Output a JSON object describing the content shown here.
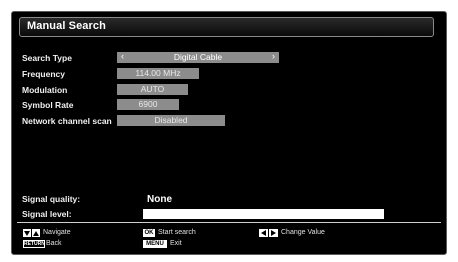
{
  "title": "Manual Search",
  "fields": {
    "search_type": {
      "label": "Search Type",
      "value": "Digital Cable"
    },
    "frequency": {
      "label": "Frequency",
      "value": "114.00 MHz"
    },
    "modulation": {
      "label": "Modulation",
      "value": "AUTO"
    },
    "symbol_rate": {
      "label": "Symbol Rate",
      "value": "6900"
    },
    "network_scan": {
      "label": "Network channel scan",
      "value": "Disabled"
    }
  },
  "signal": {
    "quality_label": "Signal quality:",
    "quality_value": "None",
    "level_label": "Signal level:",
    "level": 1.0
  },
  "footer": {
    "navigate": "Navigate",
    "back": "Back",
    "return_key": "RETURN",
    "ok_key": "OK",
    "start_search": "Start search",
    "menu_key": "MENU",
    "exit": "Exit",
    "change_value": "Change Value"
  },
  "icons": [
    "arrow-left-icon",
    "arrow-right-icon",
    "nav-down-icon",
    "nav-up-icon",
    "left-key-icon",
    "right-key-icon"
  ],
  "colors": {
    "background": "#000000",
    "value_box": "#8c8c8c",
    "text": "#ffffff"
  }
}
